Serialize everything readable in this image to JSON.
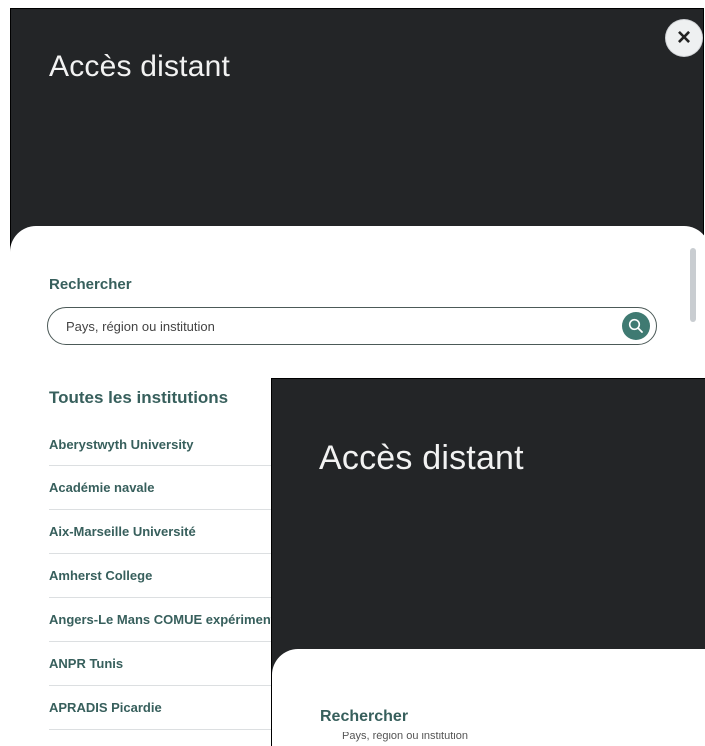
{
  "modal": {
    "title": "Accès distant",
    "search_label": "Rechercher",
    "search_placeholder": "Pays, région ou institution",
    "list_title": "Toutes les institutions",
    "institutions": [
      "Aberystwyth University",
      "Académie navale",
      "Aix-Marseille Université",
      "Amherst College",
      "Angers-Le Mans COMUE expérimentale",
      "ANPR Tunis",
      "APRADIS Picardie"
    ]
  },
  "overlay": {
    "title": "Accès distant",
    "search_label": "Rechercher",
    "search_placeholder": "Pays, région ou institution"
  },
  "icons": {
    "close": "close-icon",
    "search": "search-icon"
  },
  "colors": {
    "header_bg": "#232527",
    "accent": "#3f7a72",
    "text_accent": "#375f5c"
  }
}
